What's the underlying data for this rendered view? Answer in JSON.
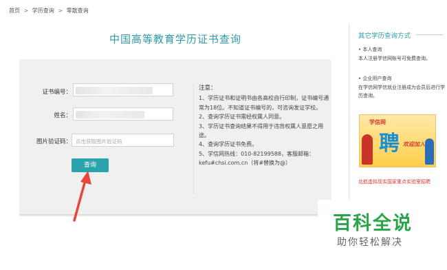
{
  "breadcrumb": {
    "home": "首页",
    "sep1": ">",
    "section": "学历查询",
    "sep2": ">",
    "current": "零散查询"
  },
  "title": "中国高等教育学历证书查询",
  "form": {
    "cert_label": "证书编号：",
    "name_label": "姓名：",
    "captcha_label": "图片验证码：",
    "captcha_placeholder": "点击获取图片验证码",
    "query_button": "查询"
  },
  "notes": {
    "heading": "注意：",
    "items": [
      "1、学历证书和证明书由各高校自行印制，证书编号通常为18位。不知道证书编号的，可咨询发证学校。",
      "2、查询学历证书需经权属人同意。",
      "3、学历证书查询结果不得用于违背权属人意愿之用途。",
      "4、查询学历证书免费。",
      "5、学信网热线：010-82199588，客服邮箱：kefu#chsi.com.cn（将#替换为@）"
    ]
  },
  "sidebar": {
    "title": "其它学历查询方式",
    "personal_head": "• 本人查询",
    "personal_text": "本人注册学信网账号可免费查询。",
    "company_head": "• 企业用户查询",
    "company_text": "在学信网学信就业注册成为会员后进行学历查询。",
    "banner_logo": "学信网",
    "banner_big": "聘",
    "banner_small": "欢迎加入",
    "link": "北航虚拟现实国家重点实验室招聘"
  },
  "watermark": {
    "title": "百科全说",
    "subtitle": "助你轻松解决"
  },
  "colors": {
    "accent": "#2ba3ac",
    "title": "#2e9aa6",
    "arrow": "#e8453c",
    "watermark": "#2aa447"
  }
}
